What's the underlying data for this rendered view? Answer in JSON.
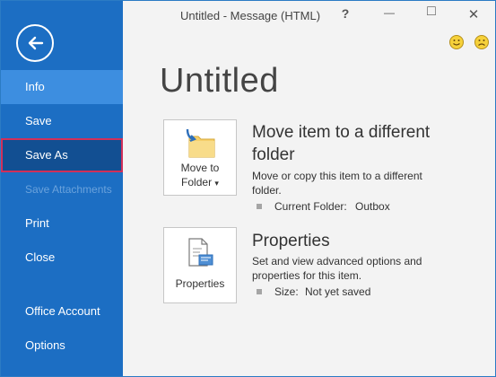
{
  "window": {
    "title": "Untitled - Message (HTML)",
    "help_label": "?",
    "minimize_label": "—",
    "restore_label": "□",
    "close_label": "✕"
  },
  "sidebar": {
    "back_icon": "back-arrow-icon",
    "items": [
      {
        "label": "Info",
        "state": "active"
      },
      {
        "label": "Save",
        "state": "normal"
      },
      {
        "label": "Save As",
        "state": "hovered"
      },
      {
        "label": "Save Attachments",
        "state": "disabled"
      },
      {
        "label": "Print",
        "state": "normal"
      },
      {
        "label": "Close",
        "state": "normal"
      },
      {
        "label": "Office Account",
        "state": "normal"
      },
      {
        "label": "Options",
        "state": "normal"
      }
    ]
  },
  "main": {
    "page_title": "Untitled",
    "move": {
      "button_line1": "Move to",
      "button_line2": "Folder",
      "dropdown_glyph": "▾",
      "heading_line1": "Move item to a different",
      "heading_line2": "folder",
      "desc_line1": "Move or copy this item to a different",
      "desc_line2": "folder.",
      "meta_label": "Current Folder:",
      "meta_value": "Outbox"
    },
    "properties": {
      "button_label": "Properties",
      "heading": "Properties",
      "desc_line1": "Set and view advanced options and",
      "desc_line2": "properties for this item.",
      "meta_label": "Size:",
      "meta_value": "Not yet saved"
    }
  },
  "colors": {
    "sidebar_bg": "#1c6ec3",
    "active_item": "#3d8ee0",
    "hover_outline": "#d0305a"
  }
}
